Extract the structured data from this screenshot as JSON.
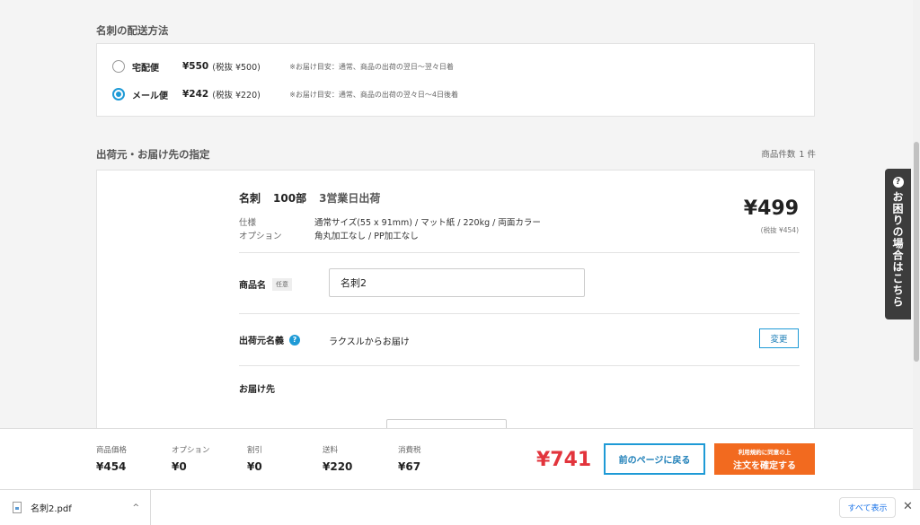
{
  "shipping": {
    "title": "名刺の配送方法",
    "options": [
      {
        "name": "宅配便",
        "price": "¥550",
        "tax": "(税抜 ¥500)",
        "note": "※お届け目安：通常、商品の出荷の翌日〜翌々日着",
        "selected": false
      },
      {
        "name": "メール便",
        "price": "¥242",
        "tax": "(税抜 ¥220)",
        "note": "※お届け目安：通常、商品の出荷の翌々日〜4日後着",
        "selected": true
      }
    ]
  },
  "destination": {
    "title": "出荷元・お届け先の指定",
    "count_label": "商品件数",
    "count_value": "1 件"
  },
  "item": {
    "name": "名刺",
    "qty": "100部",
    "business_days": "3営業日出荷",
    "spec_label": "仕様",
    "spec_value": "通常サイズ(55 x 91mm) / マット紙 / 220kg / 両面カラー",
    "option_label": "オプション",
    "option_value": "角丸加工なし / PP加工なし",
    "price": "¥499",
    "price_tax": "(税抜 ¥454)",
    "product_name_label": "商品名",
    "optional_tag": "任意",
    "product_name_value": "名刺2",
    "sender_label": "出荷元名義",
    "sender_help_icon": "?",
    "sender_value": "ラクスルからお届け",
    "change_label": "変更",
    "deliver_to_label": "お届け先"
  },
  "help_tab": {
    "icon": "?",
    "label": "お困りの場合はこちら"
  },
  "footer": {
    "items": [
      {
        "label": "商品価格",
        "value": "¥454"
      },
      {
        "label": "オプション",
        "value": "¥0"
      },
      {
        "label": "割引",
        "value": "¥0"
      },
      {
        "label": "送料",
        "value": "¥220"
      },
      {
        "label": "消費税",
        "value": "¥67"
      }
    ],
    "total": "¥741",
    "back_label": "前のページに戻る",
    "confirm_sub": "利用規約に同意の上",
    "confirm_label": "注文を確定する"
  },
  "downloads": {
    "file_name": "名刺2.pdf",
    "caret": "^",
    "show_all": "すべて表示",
    "close": "✕"
  }
}
